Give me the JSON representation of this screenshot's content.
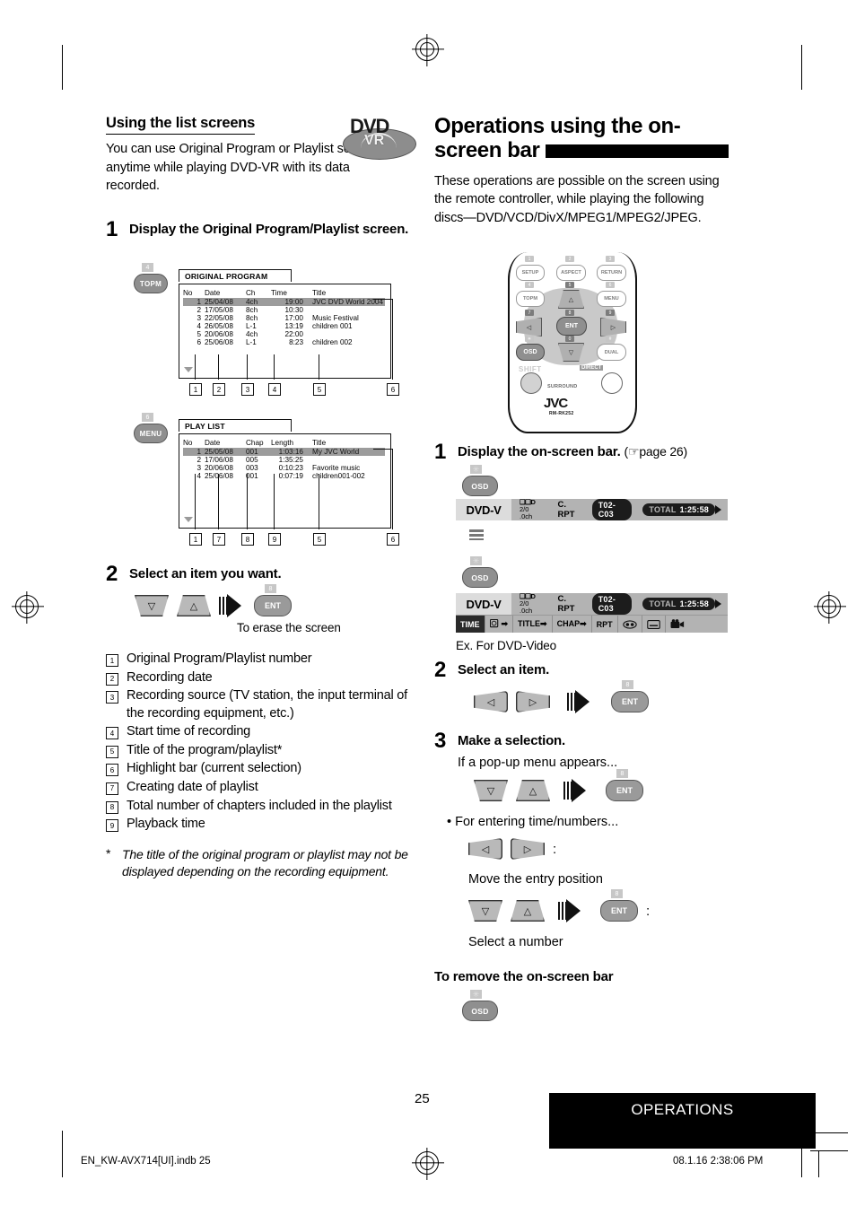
{
  "left": {
    "section_title": "Using the list screens",
    "intro": "You can use Original Program or Playlist screen anytime while playing DVD-VR with its data recorded.",
    "logo": {
      "top": "DVD",
      "bottom": "VR"
    },
    "step1": {
      "num": "1",
      "text": "Display the Original Program/Playlist screen."
    },
    "topm_button": {
      "label": "TOPM",
      "badge": "4"
    },
    "menu_button": {
      "label": "MENU",
      "badge": "6"
    },
    "original_program": {
      "tab": "ORIGINAL PROGRAM",
      "headers": [
        "No",
        "Date",
        "Ch",
        "Time",
        "Title"
      ],
      "rows": [
        [
          "1",
          "25/04/08",
          "4ch",
          "19:00",
          "JVC DVD World 2004"
        ],
        [
          "2",
          "17/05/08",
          "8ch",
          "10:30",
          ""
        ],
        [
          "3",
          "22/05/08",
          "8ch",
          "17:00",
          "Music Festival"
        ],
        [
          "4",
          "26/05/08",
          "L-1",
          "13:19",
          "children 001"
        ],
        [
          "5",
          "20/06/08",
          "4ch",
          "22:00",
          ""
        ],
        [
          "6",
          "25/06/08",
          "L-1",
          "8:23",
          "children 002"
        ]
      ],
      "highlight_row": 0,
      "callouts": [
        "1",
        "2",
        "3",
        "4",
        "5",
        "6"
      ]
    },
    "play_list": {
      "tab": "PLAY LIST",
      "headers": [
        "No",
        "Date",
        "Chap",
        "Length",
        "Title"
      ],
      "rows": [
        [
          "1",
          "25/05/08",
          "001",
          "1:03:16",
          "My JVC World"
        ],
        [
          "2",
          "17/06/08",
          "005",
          "1:35:25",
          ""
        ],
        [
          "3",
          "20/06/08",
          "003",
          "0:10:23",
          "Favorite music"
        ],
        [
          "4",
          "25/06/08",
          "001",
          "0:07:19",
          "children001-002"
        ]
      ],
      "highlight_row": 0,
      "callouts": [
        "1",
        "7",
        "8",
        "9",
        "5",
        "6"
      ]
    },
    "step2": {
      "num": "2",
      "text": "Select an item you want."
    },
    "keys_step2": {
      "down": "▽",
      "up": "△",
      "ent": "ENT",
      "ent_badge": "8"
    },
    "erase_caption": "To erase the screen",
    "legend": [
      {
        "n": "1",
        "label": "Original Program/Playlist number"
      },
      {
        "n": "2",
        "label": "Recording date"
      },
      {
        "n": "3",
        "label": "Recording source (TV station, the input terminal of the recording equipment, etc.)"
      },
      {
        "n": "4",
        "label": "Start time of recording"
      },
      {
        "n": "5",
        "label": "Title of the program/playlist*"
      },
      {
        "n": "6",
        "label": "Highlight bar (current selection)"
      },
      {
        "n": "7",
        "label": "Creating date of playlist"
      },
      {
        "n": "8",
        "label": "Total number of chapters included in the playlist"
      },
      {
        "n": "9",
        "label": "Playback time"
      }
    ],
    "footnote": {
      "marker": "*",
      "text": "The title of the original program or playlist may not be displayed depending on the recording equipment."
    }
  },
  "right": {
    "heading": "Operations using the on-screen bar",
    "intro": "These operations are possible on the screen using the remote controller, while playing the following discs—DVD/VCD/DivX/MPEG1/MPEG2/JPEG.",
    "remote": {
      "buttons": [
        {
          "label": "SETUP",
          "badge": "1"
        },
        {
          "label": "ASPECT",
          "badge": "2"
        },
        {
          "label": "RETURN",
          "badge": "3"
        },
        {
          "label": "TOPM",
          "badge": "4"
        },
        {
          "label": "△",
          "badge": "5"
        },
        {
          "label": "MENU",
          "badge": "6"
        },
        {
          "label": "◁",
          "badge": "7"
        },
        {
          "label": "ENT",
          "badge": "8"
        },
        {
          "label": "▷",
          "badge": "9"
        },
        {
          "label": "OSD",
          "badge": "✳"
        },
        {
          "label": "▽",
          "badge": "0"
        },
        {
          "label": "DUAL",
          "badge": "#"
        }
      ],
      "shift": "SHIFT",
      "direct": "DIRECT",
      "surround": "SURROUND",
      "brand": "JVC",
      "model": "RM-RK252"
    },
    "step1": {
      "num": "1",
      "text": "Display the on-screen bar.",
      "ref": "(☞page 26)"
    },
    "osd_button": {
      "label": "OSD",
      "badge": "✳"
    },
    "osbar": {
      "disc_type": "DVD-V",
      "audio_format_line1": "❑❑D",
      "audio_format_line2": "2/0 .0ch",
      "repeat": "C. RPT",
      "title_chapter": "T02-C03",
      "total_label": "TOTAL",
      "total_time": "1:25:58",
      "row2": [
        {
          "label": "TIME",
          "selected": true
        },
        {
          "label": "⏱➡",
          "selected": false
        },
        {
          "label": "TITLE➡",
          "selected": false
        },
        {
          "label": "CHAP➡",
          "selected": false
        },
        {
          "label": "RPT",
          "selected": false
        },
        {
          "label": "audio-icon",
          "selected": false
        },
        {
          "label": "subtitle-icon",
          "selected": false
        },
        {
          "label": "angle-icon",
          "selected": false
        }
      ]
    },
    "example_caption": "Ex. For DVD-Video",
    "step2": {
      "num": "2",
      "text": "Select an item."
    },
    "keys_step2": {
      "left": "◁",
      "right": "▷",
      "ent": "ENT",
      "ent_badge": "8"
    },
    "step3": {
      "num": "3",
      "text": "Make a selection."
    },
    "step3_note": "If a pop-up menu appears...",
    "keys_step3": {
      "down": "▽",
      "up": "△",
      "ent": "ENT",
      "ent_badge": "8"
    },
    "bullet_entering": "•  For entering time/numbers...",
    "keys_lr": {
      "left": "◁",
      "right": "▷",
      "colon": ":"
    },
    "move_caption": "Move the entry position",
    "keys_updown": {
      "down": "▽",
      "up": "△",
      "ent": "ENT",
      "ent_badge": "8",
      "colon": ":"
    },
    "select_caption": "Select a number",
    "remove_heading": "To remove the on-screen bar",
    "remove_osd": {
      "label": "OSD",
      "badge": "✳"
    }
  },
  "footer": {
    "page_number": "25",
    "section_tag": "OPERATIONS",
    "file_name": "EN_KW-AVX714[UI].indb   25",
    "timestamp": "08.1.16   2:38:06 PM"
  }
}
